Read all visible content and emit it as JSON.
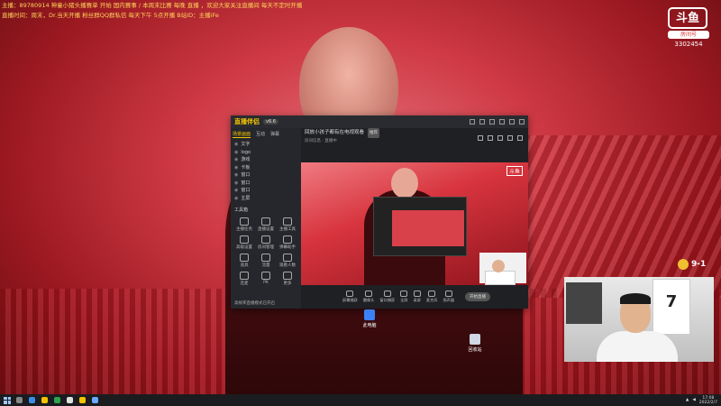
{
  "ticker": {
    "line1": "主播：89780914 神童小猪头播赛单 开始 国内赛事 / 本周末比赛 每晚 直播 ，欢迎大家关注直播间 每天不定时开播",
    "line2": "直播时间：周末，Dr.当天开播 粉丝群QQ群私信    每天下午 5点开播    B站ID：主播iFe",
    "line3": ""
  },
  "logo": {
    "mark": "斗鱼",
    "sub": "房间号",
    "room_number": "3302454"
  },
  "obs": {
    "brand": "直播伴侣",
    "version": "v6.6",
    "tabs": [
      "场景画面",
      "互动",
      "弹幕"
    ],
    "sources": [
      "文字",
      "logo",
      "游戏",
      "卡板",
      "窗口",
      "窗口",
      "窗口",
      "主屏"
    ],
    "tools_title": "工具箱",
    "tools": [
      "主播任务",
      "直播设置",
      "主播工具",
      "高级设置",
      "房间管理",
      "弹幕助手",
      "道具",
      "流量",
      "观看人数",
      "连麦",
      "PK",
      "更多"
    ],
    "footer": "高帧率直播模式已开启"
  },
  "room": {
    "title": "回放小孩子都有在电视观看",
    "tag": "推荐",
    "subtitle": "房间信息 · 直播中",
    "preview_logo": "斗鱼",
    "bottom_buttons": [
      "屏幕捕获",
      "摄像头",
      "窗口捕获",
      "全屏",
      "录屏",
      "麦克风",
      "扬声器"
    ],
    "start_button": "开始直播"
  },
  "desktop_icons": [
    "此电脑",
    "回收站"
  ],
  "score": "9-1",
  "camera": {
    "jersey_number": "7"
  },
  "taskbar": {
    "time": "17:08",
    "date": "2022/2/7"
  }
}
